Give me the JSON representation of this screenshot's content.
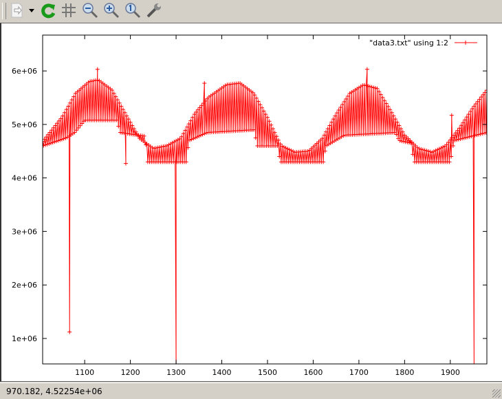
{
  "window": {
    "status_coords": "970.182, 4.52254e+06"
  },
  "toolbar": {
    "icons": [
      "export-icon",
      "dropdown-arrow-icon",
      "replot-icon",
      "grid-icon",
      "zoom-out-icon",
      "zoom-in-icon",
      "zoom-reset-icon",
      "settings-wrench-icon"
    ]
  },
  "chart_data": {
    "type": "line",
    "title": "",
    "xlabel": "",
    "ylabel": "",
    "xlim": [
      1008,
      1980
    ],
    "ylim": [
      524000,
      6670000
    ],
    "x_ticks": [
      1100,
      1200,
      1300,
      1400,
      1500,
      1600,
      1700,
      1800,
      1900
    ],
    "x_tick_labels": [
      "1100",
      "1200",
      "1300",
      "1400",
      "1500",
      "1600",
      "1700",
      "1800",
      "1900"
    ],
    "y_ticks": [
      1000000,
      2000000,
      3000000,
      4000000,
      5000000,
      6000000
    ],
    "y_tick_labels": [
      "1e+06",
      "2e+06",
      "3e+06",
      "4e+06",
      "5e+06",
      "6e+06"
    ],
    "grid": false,
    "legend": {
      "label": "\"data3.txt\" using 1:2",
      "position": "top-right"
    },
    "series_color": "#ff0000",
    "step": 2,
    "upper_envelope": [
      [
        1008,
        4680000
      ],
      [
        1050,
        5130000
      ],
      [
        1080,
        5580000
      ],
      [
        1110,
        5800000
      ],
      [
        1130,
        5830000
      ],
      [
        1160,
        5640000
      ],
      [
        1190,
        5190000
      ],
      [
        1220,
        4740000
      ],
      [
        1250,
        4550000
      ],
      [
        1280,
        4600000
      ],
      [
        1310,
        4740000
      ],
      [
        1340,
        5190000
      ],
      [
        1370,
        5500000
      ],
      [
        1410,
        5740000
      ],
      [
        1440,
        5770000
      ],
      [
        1470,
        5580000
      ],
      [
        1500,
        5130000
      ],
      [
        1530,
        4600000
      ],
      [
        1560,
        4480000
      ],
      [
        1590,
        4500000
      ],
      [
        1620,
        4740000
      ],
      [
        1650,
        5190000
      ],
      [
        1680,
        5580000
      ],
      [
        1710,
        5740000
      ],
      [
        1740,
        5670000
      ],
      [
        1770,
        5250000
      ],
      [
        1800,
        4800000
      ],
      [
        1830,
        4550000
      ],
      [
        1860,
        4480000
      ],
      [
        1890,
        4600000
      ],
      [
        1920,
        4930000
      ],
      [
        1950,
        5320000
      ],
      [
        1980,
        5640000
      ]
    ],
    "lower_envelope": [
      [
        1008,
        4600000
      ],
      [
        1060,
        4750000
      ],
      [
        1078,
        4850000
      ],
      [
        1100,
        5080000
      ],
      [
        1170,
        5080000
      ],
      [
        1178,
        4850000
      ],
      [
        1232,
        4780000
      ],
      [
        1238,
        4300000
      ],
      [
        1322,
        4300000
      ],
      [
        1328,
        4700000
      ],
      [
        1368,
        4850000
      ],
      [
        1470,
        4900000
      ],
      [
        1478,
        4600000
      ],
      [
        1522,
        4600000
      ],
      [
        1528,
        4300000
      ],
      [
        1622,
        4300000
      ],
      [
        1628,
        4600000
      ],
      [
        1668,
        4800000
      ],
      [
        1780,
        4850000
      ],
      [
        1788,
        4700000
      ],
      [
        1815,
        4650000
      ],
      [
        1820,
        4300000
      ],
      [
        1900,
        4300000
      ],
      [
        1908,
        4700000
      ],
      [
        1980,
        4850000
      ]
    ],
    "outliers": [
      [
        1067,
        1120000
      ],
      [
        1128,
        6030000
      ],
      [
        1190,
        4270000
      ],
      [
        1300,
        400000
      ],
      [
        1362,
        5770000
      ],
      [
        1718,
        6030000
      ],
      [
        1903,
        5170000
      ],
      [
        1952,
        400000
      ]
    ]
  }
}
